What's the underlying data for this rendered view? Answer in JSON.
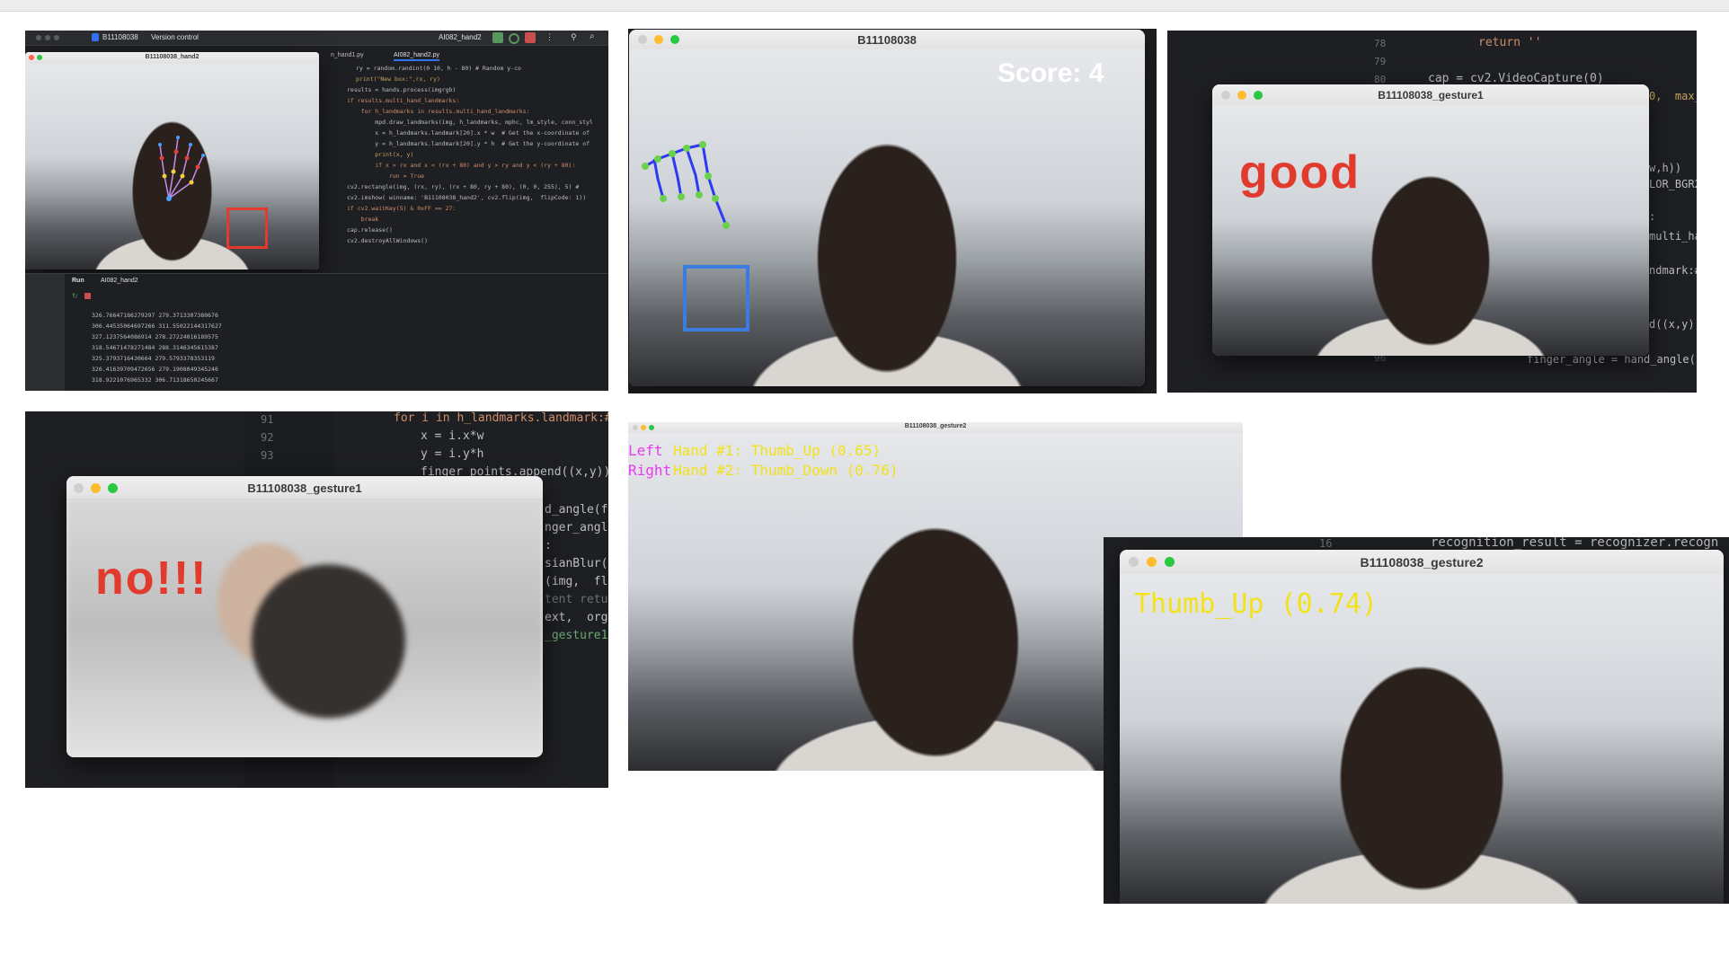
{
  "panel1": {
    "ide_project": "B11108038",
    "ide_vcs": "Version control",
    "ide_run_config": "AI082_hand2",
    "editor_tabs": [
      "n_hand1.py",
      "AI082_hand2.py"
    ],
    "window_title": "B11108038_hand2",
    "code_lines": [
      "ry = random.randint(0 10, h - 80) # Random y-co",
      "print(\"New box:\",rx, ry)",
      "results = hands.process(imgrgb)",
      "if results.multi_hand_landmarks:",
      "    for h_landmarks in results.multi_hand_landmarks:",
      "        mpd.draw_landmarks(img, h_landmarks, mphc, lm_style, conn_styl",
      "        x = h_landmarks.landmark[20].x * w  # Get the x-coordinate of",
      "        y = h_landmarks.landmark[20].y * h  # Get the y-coordinate of",
      "        print(x, y)",
      "        if x > rx and x < (rx + 80) and y > ry and y < (ry + 80):",
      "            run = True",
      "cv2.rectangle(img, (rx, ry), (rx + 80, ry + 80), (0, 0, 255), 5) #",
      "cv2.imshow( winname: 'B11108038_hand2', cv2.flip(img,  flipCode: 1))",
      "if cv2.waitKey(5) & 0xFF == 27:",
      "    break",
      "cap.release()",
      "cv2.destroyAllWindows()"
    ],
    "run_label": "Run",
    "run_tab": "AI082_hand2",
    "output_lines": [
      "326.76647186279297 279.3713307380676",
      "306.44535064697266 311.55022144317627",
      "327.1237564086914 278.27224016189575",
      "318.54671478271484 288.3146345615387",
      "325.3793716430664 279.5793378353119",
      "326.41639709472656 279.1908049345246",
      "318.9221076965332 306.71318650245667"
    ]
  },
  "panel2": {
    "window_title": "B11108038",
    "score_text": "Score: 4"
  },
  "panel3": {
    "window_title": "B11108038_gesture1",
    "overlay_text": "good",
    "code_top": [
      "return ''",
      "cap = cv2.VideoCapture(0)"
    ],
    "line_numbers": [
      "78",
      "79",
      "80"
    ],
    "line_number_bottom": "96",
    "code_right": [
      "0,  max_",
      "w,h))",
      "LOR_BGR2",
      ":",
      "multi_ha",
      "ndmark:#",
      "d((x,y))"
    ],
    "code_bottom": "finger_angle = hand_angle(f"
  },
  "panel4": {
    "window_title": "B11108038_gesture1",
    "overlay_text": "no!!!",
    "line_numbers": [
      "91",
      "92",
      "93"
    ],
    "code_lines": [
      "for i in h_landmarks.landmark:#",
      "x = i.x*w",
      "y = i.y*h",
      "finger_points.append((x,y))"
    ],
    "code_right": [
      "d_angle(f",
      "nger_angl",
      ":",
      "sianBlur(",
      "(img,  flip",
      "tent retu",
      "ext,  org:",
      "_gesture1'"
    ]
  },
  "panel5": {
    "window_title": "B11108038_gesture2",
    "line1_side": "Left",
    "line1_text": "Hand #1: Thumb_Up (0.65)",
    "line2_side": "Right",
    "line2_text": "Hand #2: Thumb_Down (0.76)"
  },
  "panel6": {
    "window_title": "B11108038_gesture2",
    "overlay_text": "Thumb_Up (0.74)",
    "line_number": "16",
    "code_line": "recognition_result = recognizer.recogn"
  }
}
